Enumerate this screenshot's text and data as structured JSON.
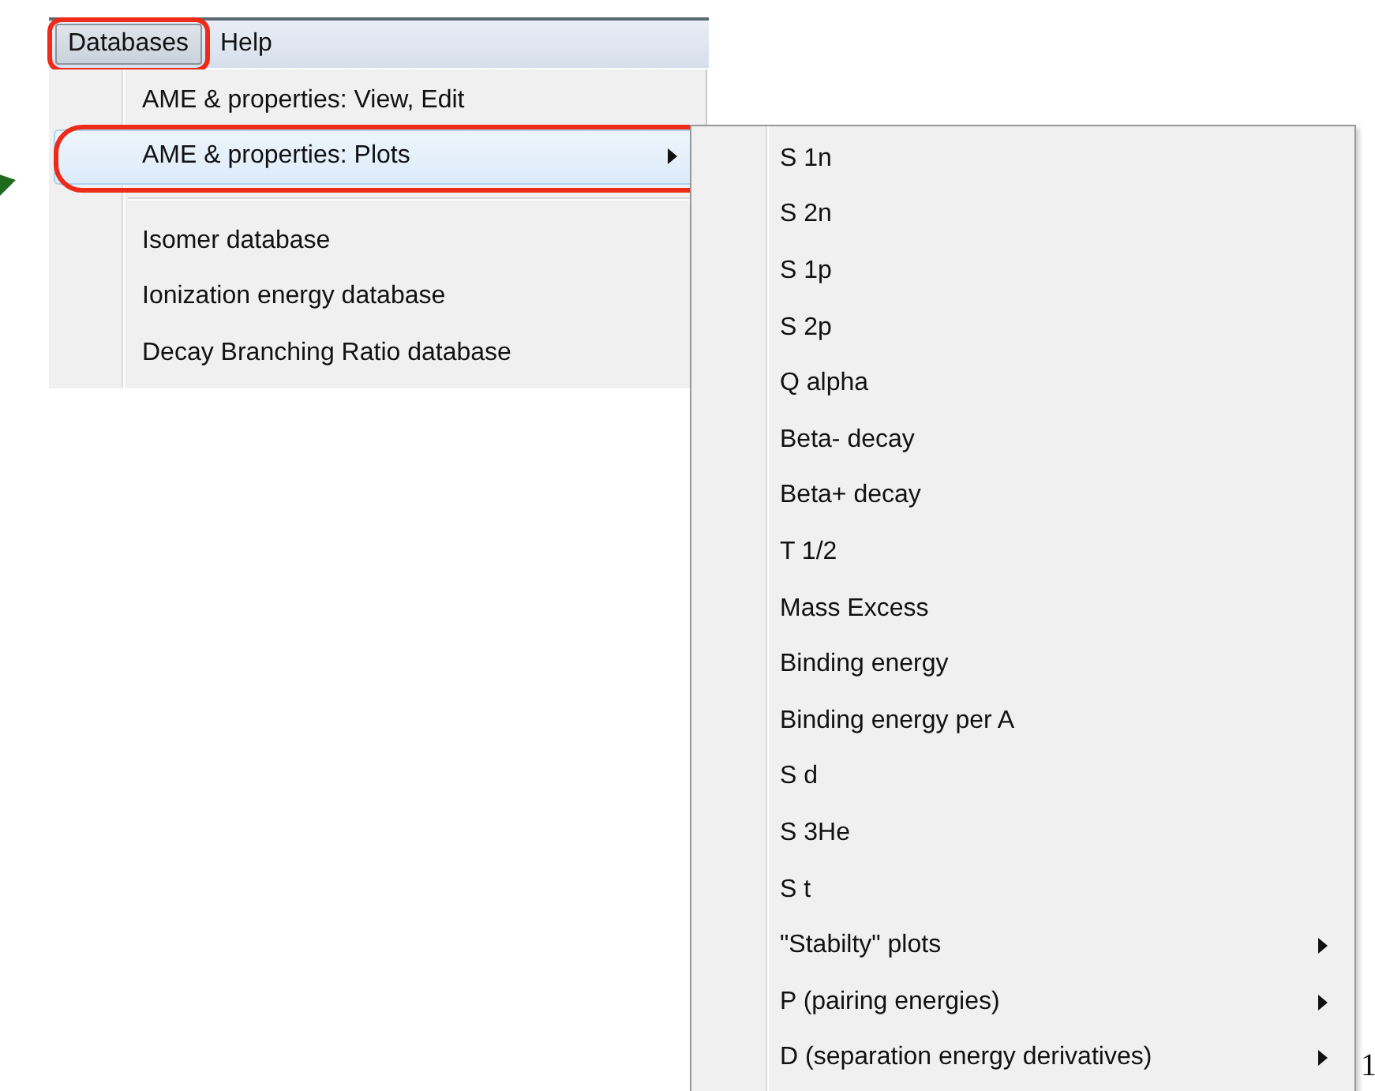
{
  "menubar": [
    {
      "label": "Databases",
      "selected": true,
      "circled": true
    },
    {
      "label": "Help",
      "selected": false,
      "circled": false
    }
  ],
  "menu": [
    {
      "kind": "item",
      "label": "AME & properties: View, Edit",
      "selected": false,
      "submenu": false,
      "circled": false
    },
    {
      "kind": "item",
      "label": "AME & properties: Plots",
      "selected": true,
      "submenu": true,
      "circled": true
    },
    {
      "kind": "separator"
    },
    {
      "kind": "item",
      "label": "Isomer database",
      "selected": false,
      "submenu": false,
      "circled": false
    },
    {
      "kind": "item",
      "label": "Ionization energy database",
      "selected": false,
      "submenu": false,
      "circled": false
    },
    {
      "kind": "item",
      "label": "Decay Branching Ratio database",
      "selected": false,
      "submenu": false,
      "circled": false
    }
  ],
  "submenu": [
    {
      "label": "S 1n",
      "submenu": false
    },
    {
      "label": "S 2n",
      "submenu": false
    },
    {
      "label": "S 1p",
      "submenu": false
    },
    {
      "label": "S 2p",
      "submenu": false
    },
    {
      "label": "Q alpha",
      "submenu": false
    },
    {
      "label": "Beta- decay",
      "submenu": false
    },
    {
      "label": "Beta+ decay",
      "submenu": false
    },
    {
      "label": "T 1/2",
      "submenu": false
    },
    {
      "label": "Mass Excess",
      "submenu": false
    },
    {
      "label": "Binding energy",
      "submenu": false
    },
    {
      "label": "Binding energy per A",
      "submenu": false
    },
    {
      "label": "S d",
      "submenu": false
    },
    {
      "label": "S 3He",
      "submenu": false
    },
    {
      "label": "S t",
      "submenu": false
    },
    {
      "label": "\"Stabilty\" plots",
      "submenu": true
    },
    {
      "label": "P (pairing energies)",
      "submenu": true
    },
    {
      "label": "D (separation energy derivatives)",
      "submenu": true
    }
  ],
  "annotation_arrow": {
    "color": "#1e6b1e"
  },
  "edge_text": "1"
}
